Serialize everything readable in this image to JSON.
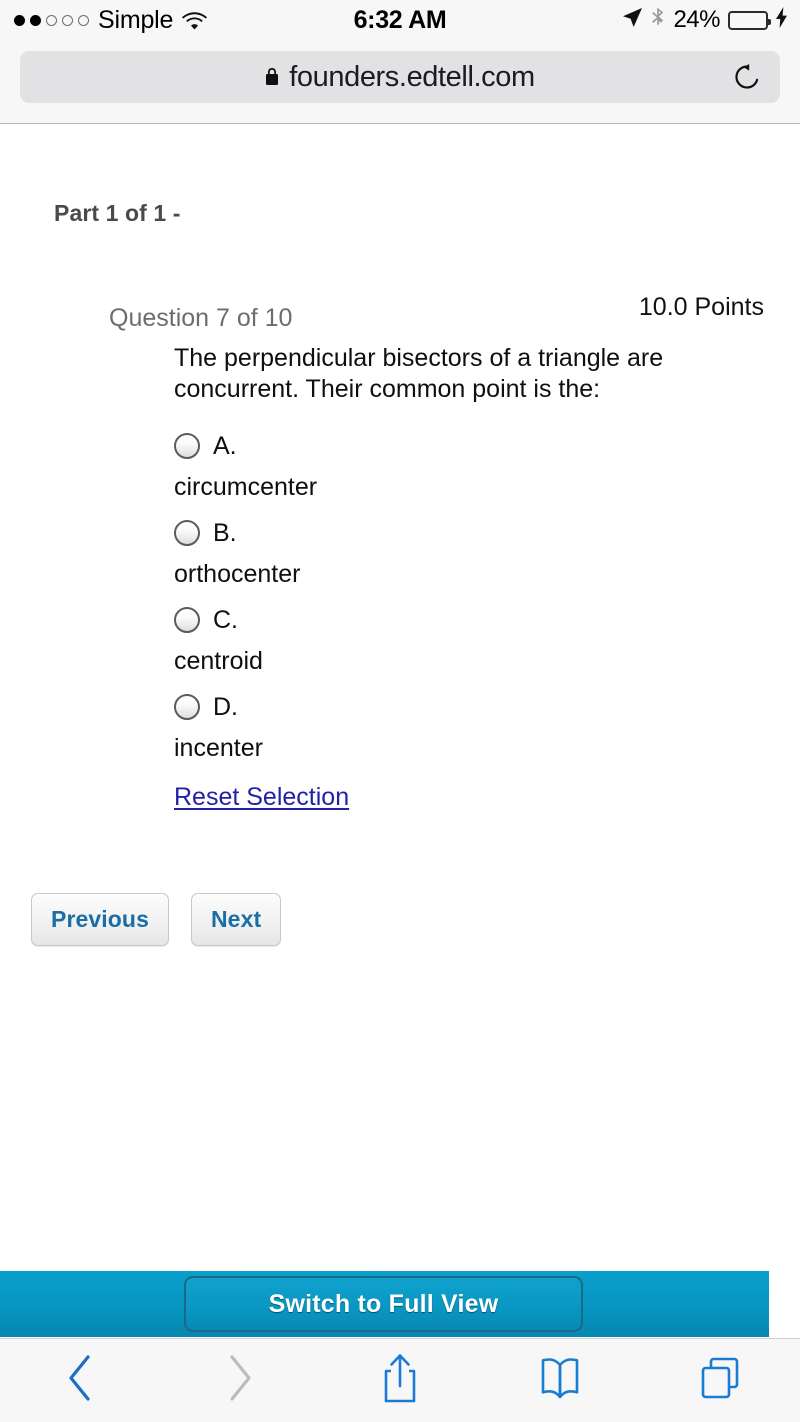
{
  "status_bar": {
    "signal_dots_total": 5,
    "signal_dots_filled": 2,
    "carrier": "Simple",
    "wifi_icon": "wifi-icon",
    "time": "6:32 AM",
    "location_icon": "location-arrow-icon",
    "bluetooth_icon": "bluetooth-icon",
    "battery_percent": "24%",
    "battery_level": 24,
    "battery_color": "#fdc719",
    "charging_icon": "lightning-bolt-icon"
  },
  "browser": {
    "lock_icon": "lock-icon",
    "url": "founders.edtell.com",
    "reload_icon": "reload-icon"
  },
  "page": {
    "part_label": "Part 1 of 1 -",
    "question_number": "Question 7 of 10",
    "points": "10.0 Points",
    "question_text": "The perpendicular bisectors of a triangle are concurrent. Their common point is the:",
    "options": [
      {
        "letter": "A.",
        "text": "circumcenter",
        "selected": false
      },
      {
        "letter": "B.",
        "text": "orthocenter",
        "selected": false
      },
      {
        "letter": "C.",
        "text": "centroid",
        "selected": false
      },
      {
        "letter": "D.",
        "text": "incenter",
        "selected": false
      }
    ],
    "reset_link": "Reset Selection",
    "previous_button": "Previous",
    "next_button": "Next",
    "link_color": "#2222a8",
    "button_text_color": "#1b6ea5"
  },
  "full_view": {
    "label": "Switch to Full View",
    "bar_color": "#0895c1"
  },
  "toolbar": {
    "back_icon": "back-chevron-icon",
    "forward_icon": "forward-chevron-icon",
    "share_icon": "share-icon",
    "bookmarks_icon": "bookmarks-book-icon",
    "tabs_icon": "tabs-icon",
    "enabled_color": "#1a7ad4",
    "disabled_color": "#bcbcbe"
  }
}
